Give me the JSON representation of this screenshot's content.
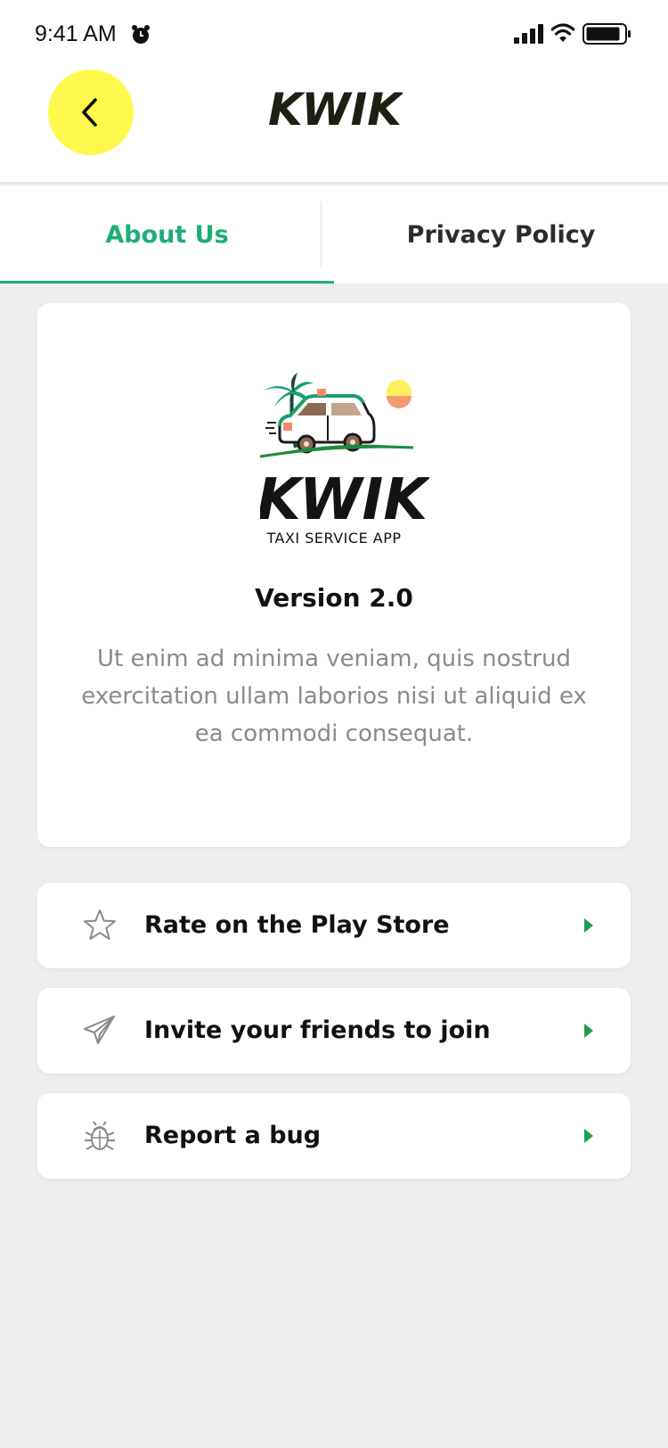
{
  "status_bar": {
    "time": "9:41 AM"
  },
  "header": {
    "logo_text": "KWIK"
  },
  "tabs": [
    {
      "label": "About Us",
      "active": true
    },
    {
      "label": "Privacy Policy",
      "active": false
    }
  ],
  "about": {
    "logo_text": "KWIK",
    "logo_subtitle": "TAXI SERVICE APP",
    "version": "Version 2.0",
    "description": "Ut enim ad minima veniam, quis nostrud exercitation ullam laborios nisi ut aliquid ex ea commodi consequat."
  },
  "actions": [
    {
      "label": "Rate on the Play Store",
      "icon": "star-icon"
    },
    {
      "label": "Invite your friends to join",
      "icon": "paper-plane-icon"
    },
    {
      "label": "Report a bug",
      "icon": "bug-icon"
    }
  ],
  "colors": {
    "accent": "#1dae77",
    "back_button": "#fff94f",
    "background": "#eeeeef"
  }
}
